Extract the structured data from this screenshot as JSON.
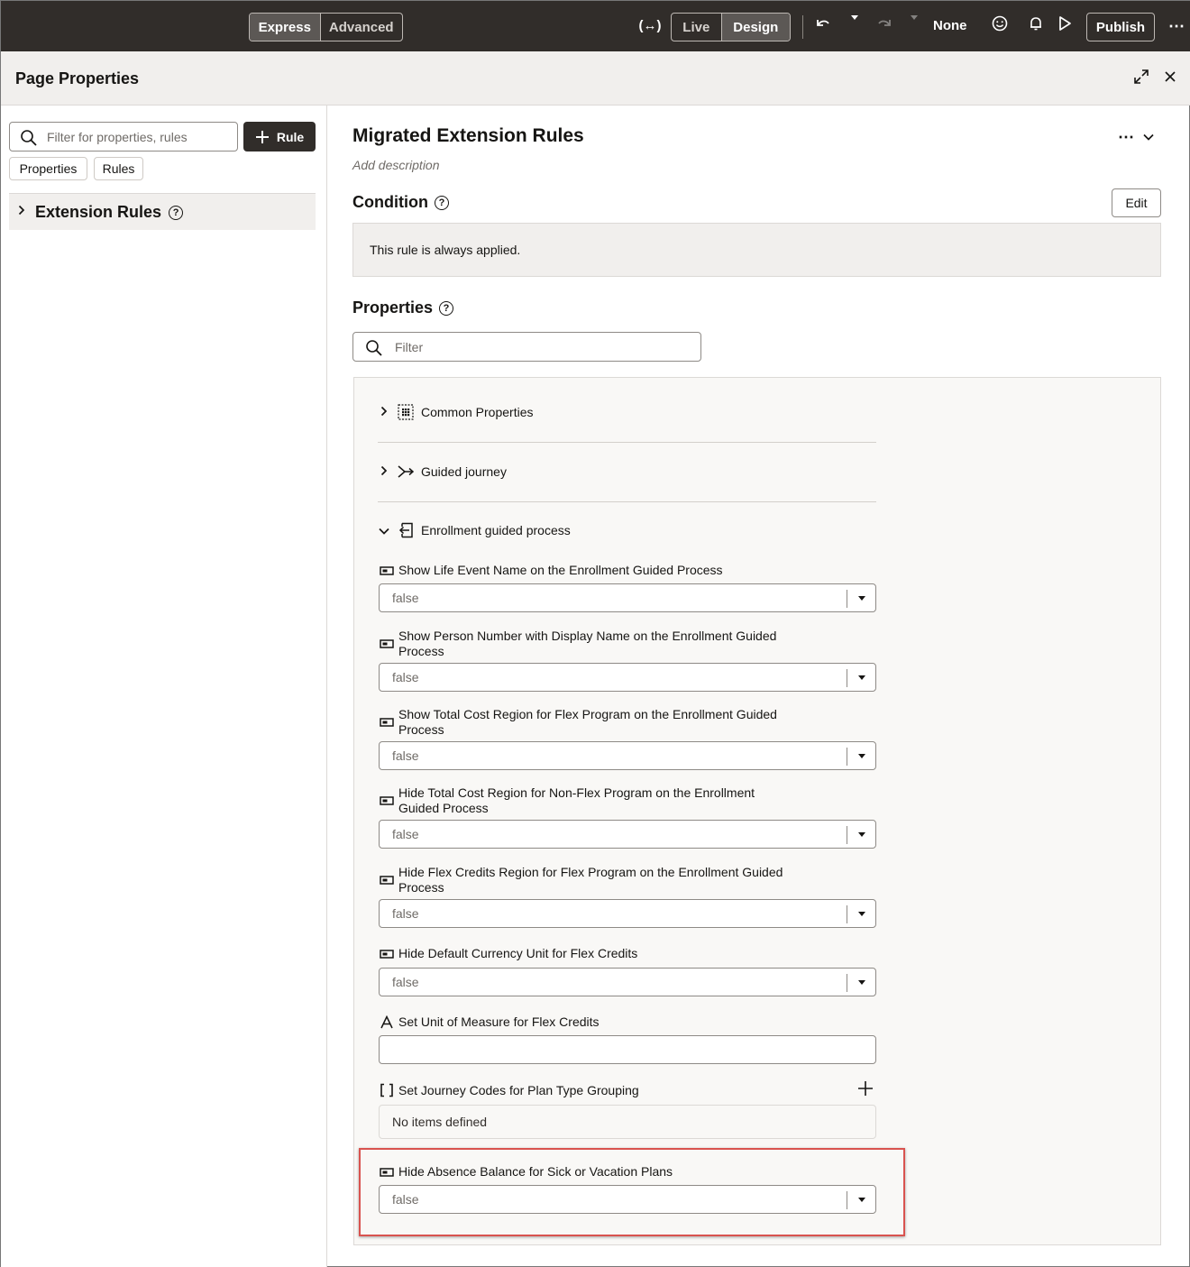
{
  "topbar": {
    "mode_express": "Express",
    "mode_advanced": "Advanced",
    "view_live": "Live",
    "view_design": "Design",
    "sandbox_label": "None",
    "publish_label": "Publish"
  },
  "panel": {
    "title": "Page Properties"
  },
  "left": {
    "search_placeholder": "Filter for properties, rules",
    "rule_button": "Rule",
    "chip_properties": "Properties",
    "chip_rules": "Rules",
    "tree_item": "Extension Rules"
  },
  "rule": {
    "title": "Migrated Extension Rules",
    "description_placeholder": "Add description",
    "condition_heading": "Condition",
    "edit_button": "Edit",
    "condition_text": "This rule is always applied.",
    "properties_heading": "Properties",
    "filter_placeholder": "Filter"
  },
  "groups": [
    {
      "label": "Common Properties",
      "expanded": false
    },
    {
      "label": "Guided journey",
      "expanded": false
    },
    {
      "label": "Enrollment guided process",
      "expanded": true
    }
  ],
  "properties": [
    {
      "label": "Show Life Event Name on the Enrollment Guided Process",
      "value": "false"
    },
    {
      "label": "Show Person Number with Display Name on the Enrollment Guided Process",
      "value": "false"
    },
    {
      "label": "Show Total Cost Region for Flex Program on the Enrollment Guided Process",
      "value": "false"
    },
    {
      "label": "Hide Total Cost Region for Non-Flex Program on the Enrollment Guided Process",
      "value": "false"
    },
    {
      "label": "Hide Flex Credits Region for Flex Program on the Enrollment Guided Process",
      "value": "false"
    },
    {
      "label": "Hide Default Currency Unit for Flex Credits",
      "value": "false"
    },
    {
      "label": "Set Unit of Measure for Flex Credits",
      "value": ""
    },
    {
      "label": "Set Journey Codes for Plan Type Grouping",
      "empty_text": "No items defined"
    },
    {
      "label": "Hide Absence Balance for Sick or Vacation Plans",
      "value": "false"
    }
  ],
  "colors": {
    "topbar_bg": "#312d2a",
    "highlight_border": "#d9534f",
    "panel_bg": "#f1efed"
  }
}
